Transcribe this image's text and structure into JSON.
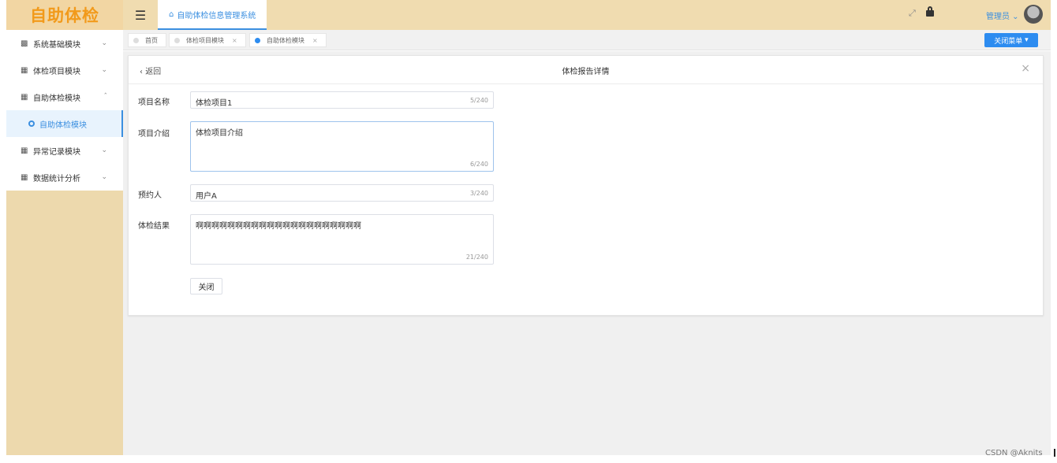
{
  "brand": {
    "logo_text": "自助体检",
    "logo_color": "#f29a1b"
  },
  "sidebar": {
    "items": [
      {
        "label": "系统基础模块",
        "icon": "grid-icon",
        "expanded": false
      },
      {
        "label": "体检项目模块",
        "icon": "grid-icon",
        "expanded": false
      },
      {
        "label": "自助体检模块",
        "icon": "grid-icon",
        "expanded": true
      },
      {
        "label": "异常记录模块",
        "icon": "grid-icon",
        "expanded": false
      },
      {
        "label": "数据统计分析",
        "icon": "grid-icon",
        "expanded": false
      }
    ],
    "active_sub": "自助体检模块"
  },
  "header": {
    "tab_title": "自助体检信息管理系统",
    "user_label": "管理员",
    "accent": "#3b8fe0"
  },
  "tabs": {
    "items": [
      {
        "label": "首页",
        "closable": false,
        "active": false
      },
      {
        "label": "体检项目模块",
        "closable": true,
        "active": false
      },
      {
        "label": "自助体检模块",
        "closable": true,
        "active": true
      }
    ],
    "close_menu_label": "关闭菜单"
  },
  "card": {
    "back_label": "返回",
    "title": "体检报告详情",
    "fields": {
      "item_name": {
        "label": "项目名称",
        "value": "体检项目1",
        "count": "5/240"
      },
      "item_intro": {
        "label": "项目介绍",
        "value": "体检项目介绍",
        "count": "6/240"
      },
      "booker": {
        "label": "预约人",
        "value": "用户A",
        "count": "3/240"
      },
      "result": {
        "label": "体检结果",
        "value": "啊啊啊啊啊啊啊啊啊啊啊啊啊啊啊啊啊啊啊啊啊",
        "count": "21/240"
      }
    },
    "close_button_label": "关闭"
  },
  "credit": "CSDN @Aknits"
}
